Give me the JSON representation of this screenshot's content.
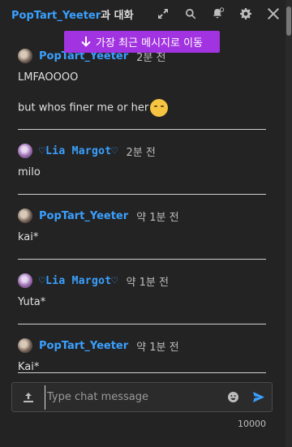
{
  "header": {
    "username": "PopTart_Yeeter",
    "title_suffix": "과 대화",
    "icons": [
      "expand-icon",
      "search-icon",
      "bell-icon",
      "gear-icon",
      "close-icon"
    ]
  },
  "jump_button": {
    "label": "가장 최근 메시지로 이동"
  },
  "messages": [
    {
      "user": "PopTart_Yeeter",
      "time": "2분 전",
      "lines": [
        "LMFAOOOO",
        "but whos finer me or her"
      ]
    },
    {
      "user": "♡Lia Margot♡",
      "time": "2분 전",
      "lines": [
        "milo"
      ]
    },
    {
      "user": "PopTart_Yeeter",
      "time": "약 1분 전",
      "lines": [
        "kai*"
      ]
    },
    {
      "user": "♡Lia Margot♡",
      "time": "약 1분 전",
      "lines": [
        "Yuta*"
      ]
    },
    {
      "user": "PopTart_Yeeter",
      "time": "약 1분 전",
      "lines": [
        "Kai*"
      ]
    }
  ],
  "composer": {
    "placeholder": "Type chat message",
    "value": "",
    "char_limit": "10000"
  },
  "colors": {
    "accent": "#3aa0ff",
    "jump_bg": "#a233e0",
    "background": "#232323"
  }
}
